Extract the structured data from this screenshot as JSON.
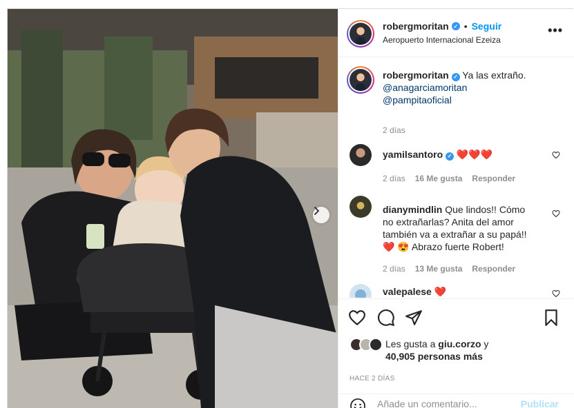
{
  "header": {
    "username": "robergmoritan",
    "follow_label": "Seguir",
    "separator": "•",
    "location": "Aeropuerto Internacional Ezeiza",
    "more_label": "•••"
  },
  "caption": {
    "username": "robergmoritan",
    "text": "Ya las extraño.",
    "mentions": [
      "@anagarciamoritan",
      "@pampitaoficial"
    ],
    "time": "2 días"
  },
  "comments": [
    {
      "username": "yamilsantoro",
      "text": "❤️❤️❤️",
      "time": "2 días",
      "likes": "16 Me gusta",
      "reply": "Responder"
    },
    {
      "username": "dianymindlin",
      "text": "Que lindos!! Cómo no extrañarlas? Anita del amor también va a extrañar a su papá!! ❤️ 😍 Abrazo fuerte Robert!",
      "time": "2 días",
      "likes": "13 Me gusta",
      "reply": "Responder"
    },
    {
      "username": "valepalese",
      "text": "❤️"
    }
  ],
  "likes": {
    "prefix": "Les gusta a",
    "user": "giu.corzo",
    "conj": "y",
    "others": "40,905 personas más"
  },
  "time_ago": "HACE 2 DÍAS",
  "comment_box": {
    "placeholder": "Añade un comentario...",
    "publish_label": "Publicar"
  },
  "icons": [
    "verified-badge-icon",
    "more-options-icon",
    "heart-icon",
    "comment-icon",
    "share-icon",
    "bookmark-icon",
    "emoji-icon",
    "next-arrow-icon"
  ],
  "colors": {
    "link_blue": "#0095f6",
    "mention_blue": "#00376b",
    "heart_red": "#ed4956",
    "muted": "#8e8e8e",
    "border": "#dbdbdb"
  }
}
